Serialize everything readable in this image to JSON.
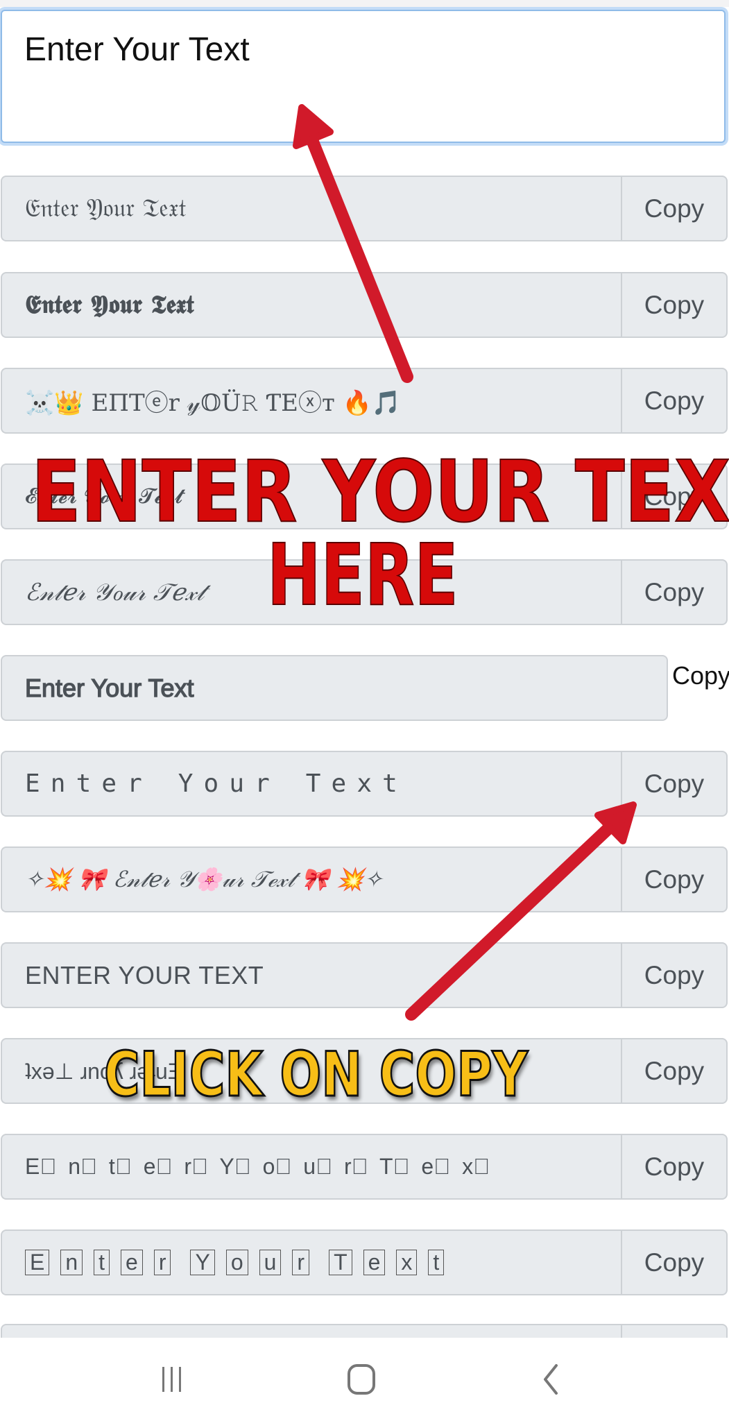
{
  "input": {
    "value": "Enter Your Text"
  },
  "styles": [
    {
      "text": "𝔈𝔫𝔱𝔢𝔯 𝔜𝔬𝔲𝔯 𝔗𝔢𝔵𝔱",
      "copy_label": "Copy"
    },
    {
      "text": "𝕰𝖓𝖙𝖊𝖗 𝖄𝖔𝖚𝖗 𝕿𝖊𝖝𝖙",
      "copy_label": "Copy"
    },
    {
      "text": "☠️👑 ΕΠΤⓔr 𝓎𝕆Ü𝚁 ƬΕⓧт 🔥🎵",
      "copy_label": "Copy"
    },
    {
      "text": "𝓔𝓷𝓽𝓮𝓻 𝓨𝓸𝓾𝓻 𝓣𝓮𝔁𝓽",
      "copy_label": "Copy"
    },
    {
      "text": "ℰ𝓃𝓉ℯ𝓇 𝒴ℴ𝓊𝓇 𝒯ℯ𝓍𝓉",
      "copy_label": "Copy"
    },
    {
      "text": "Enter Your Text",
      "copy_label": "Copy"
    },
    {
      "text": "Enter Your Text",
      "copy_label": "Copy"
    },
    {
      "text": "✧💥 🎀 ℰ𝓃𝓉ℯ𝓇 𝒴🌸𝓊𝓇 𝒯ℯ𝓍𝓉 🎀 💥✧",
      "copy_label": "Copy"
    },
    {
      "text": "ENTER YOUR TEXT",
      "copy_label": "Copy"
    },
    {
      "text": "ʇxǝ⊥ ɹnoʎ ɹǝʇuƎ",
      "copy_label": "Copy"
    },
    {
      "text": "E⃞ n⃞ t⃞ e⃞ r⃞  Y⃞ o⃞ u⃞ r⃞  T⃞ e⃞ x⃞",
      "copy_label": "Copy"
    },
    {
      "letters": [
        "E",
        "n",
        "t",
        "e",
        "r",
        "Y",
        "o",
        "u",
        "r",
        "T",
        "e",
        "x",
        "t"
      ],
      "copy_label": "Copy"
    }
  ],
  "annotations": {
    "headline_line1": "ENTER YOUR TEXT",
    "headline_line2": "HERE",
    "cta": "CLICK ON COPY",
    "arrow_color": "#d11a2a",
    "headline_color": "#d60a0a",
    "cta_color": "#f7be17"
  },
  "navbar": {
    "recents": "recent-apps",
    "home": "home",
    "back": "back"
  }
}
